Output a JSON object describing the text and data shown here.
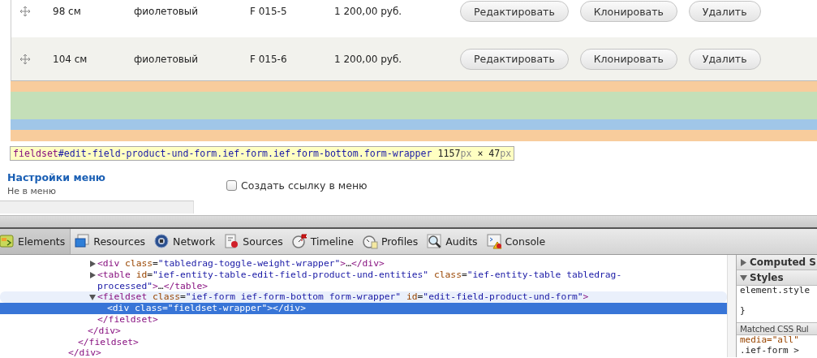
{
  "product_table": {
    "rows": [
      {
        "size": "98 см",
        "color_name": "фиолетовый",
        "sku": "F 015-5",
        "price": "1 200,00 руб.",
        "buttons": [
          "Редактировать",
          "Клонировать",
          "Удалить"
        ]
      },
      {
        "size": "104 см",
        "color_name": "фиолетовый",
        "sku": "F 015-6",
        "price": "1 200,00 руб.",
        "buttons": [
          "Редактировать",
          "Клонировать",
          "Удалить"
        ]
      }
    ]
  },
  "inspect_tooltip": {
    "selector": "fieldset#edit-field-product-und-form.ief-form.ief-form-bottom.form-wrapper",
    "size": "1157px × 47px"
  },
  "menu_settings": {
    "title": "Настройки меню",
    "summary": "Не в меню",
    "checkbox": {
      "label": "Создать ссылку в меню",
      "checked": false
    }
  },
  "devtools": {
    "tabs": [
      {
        "label": "Elements",
        "selected": true
      },
      {
        "label": "Resources",
        "selected": false
      },
      {
        "label": "Network",
        "selected": false
      },
      {
        "label": "Sources",
        "selected": false
      },
      {
        "label": "Timeline",
        "selected": false
      },
      {
        "label": "Profiles",
        "selected": false
      },
      {
        "label": "Audits",
        "selected": false
      },
      {
        "label": "Console",
        "selected": false
      }
    ],
    "dom_tree": [
      {
        "close": "</div>",
        "children": [
          {
            "close": "</fieldset>",
            "children": [
              {
                "close": "</div>",
                "children": [
                  {
                    "markup": "<div class=\"tabledrag-toggle-weight-wrapper\">…</div>",
                    "expanded": false,
                    "selected": false,
                    "hovered": false
                  },
                  {
                    "markup": "<table id=\"ief-entity-table-edit-field-product-und-entities\" class=\"ief-entity-table tabledrag-processed\">…</table>",
                    "expanded": false,
                    "selected": false,
                    "hovered": false
                  },
                  {
                    "markup": "<fieldset class=\"ief-form ief-form-bottom form-wrapper\" id=\"edit-field-product-und-form\">",
                    "expanded": true,
                    "selected": false,
                    "hovered": true,
                    "close": "</fieldset>",
                    "children": [
                      {
                        "markup": "<div class=\"fieldset-wrapper\"></div>",
                        "selected": true
                      }
                    ]
                  }
                ]
              }
            ]
          }
        ]
      }
    ],
    "styles_sidebar": {
      "sections": [
        {
          "title": "Computed S",
          "expanded": false
        },
        {
          "title": "Styles",
          "expanded": true,
          "lines": [
            "element.style",
            "}"
          ]
        },
        {
          "title": "Matched CSS Rul",
          "kind": "subheader",
          "lines": [
            "media=\"all\"",
            ".ief-form >"
          ]
        }
      ]
    }
  }
}
